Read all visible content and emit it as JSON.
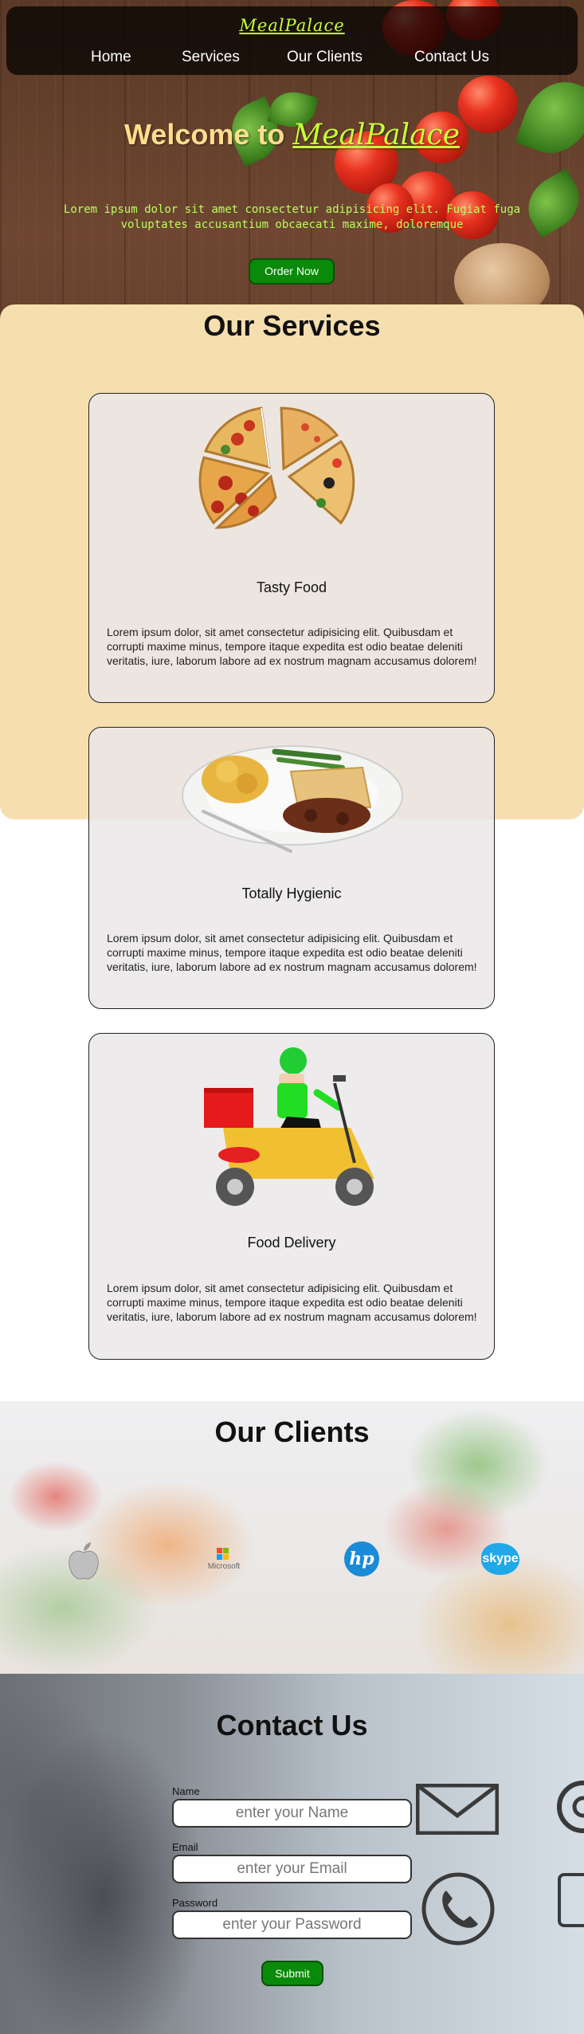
{
  "nav": {
    "brand": "MealPalace",
    "items": [
      "Home",
      "Services",
      "Our Clients",
      "Contact Us"
    ]
  },
  "hero": {
    "welcome": "Welcome to",
    "welcome_accent": "MealPalace",
    "text": "Lorem ipsum dolor sit amet consectetur adipisicing elit. Fugiat fuga voluptates accusantium obcaecati maxime, doloremque",
    "order_button": "Order Now"
  },
  "services": {
    "title": "Our Services",
    "cards": [
      {
        "title": "Tasty Food",
        "image_icon": "pizza-icon",
        "text": "Lorem ipsum dolor, sit amet consectetur adipisicing elit. Quibusdam et corrupti maxime minus, tempore itaque expedita est odio beatae deleniti veritatis, iure, laborum labore ad ex nostrum magnam accusamus dolorem!"
      },
      {
        "title": "Totally Hygienic",
        "image_icon": "meal-plate-icon",
        "text": "Lorem ipsum dolor, sit amet consectetur adipisicing elit. Quibusdam et corrupti maxime minus, tempore itaque expedita est odio beatae deleniti veritatis, iure, laborum labore ad ex nostrum magnam accusamus dolorem!"
      },
      {
        "title": "Food Delivery",
        "image_icon": "delivery-scooter-icon",
        "text": "Lorem ipsum dolor, sit amet consectetur adipisicing elit. Quibusdam et corrupti maxime minus, tempore itaque expedita est odio beatae deleniti veritatis, iure, laborum labore ad ex nostrum magnam accusamus dolorem!"
      }
    ]
  },
  "clients": {
    "title": "Our Clients",
    "logos": [
      {
        "icon": "apple-logo-icon"
      },
      {
        "icon": "microsoft-logo-icon",
        "text": "Microsoft"
      },
      {
        "icon": "hp-logo-icon",
        "text": "hp"
      },
      {
        "icon": "skype-logo-icon",
        "text": "skype"
      }
    ]
  },
  "contact": {
    "title": "Contact Us",
    "fields": [
      {
        "label": "Name",
        "placeholder": "enter your Name"
      },
      {
        "label": "Email",
        "placeholder": "enter your Email"
      },
      {
        "label": "Password",
        "placeholder": "enter your Password"
      }
    ],
    "submit": "Submit"
  },
  "colors": {
    "accent_green": "#0a8a0a",
    "brand_lime": "#c7ff3a",
    "welcome_gold": "#ffdd8e",
    "services_bg": "#f6dfaf"
  }
}
